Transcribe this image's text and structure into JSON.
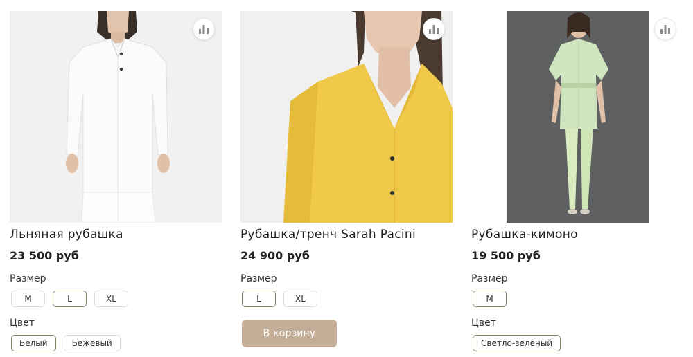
{
  "products": [
    {
      "title": "Льняная рубашка",
      "price": "23 500 руб",
      "size_label": "Размер",
      "sizes": [
        "M",
        "L",
        "XL"
      ],
      "selected_size": "L",
      "color_label": "Цвет",
      "colors": [
        "Белый",
        "Бежевый"
      ],
      "selected_color": "Белый",
      "compare_icon": "bar-chart-icon"
    },
    {
      "title": "Рубашка/тренч Sarah Pacini",
      "price": "24 900 руб",
      "size_label": "Размер",
      "sizes": [
        "L",
        "XL"
      ],
      "selected_size": "L",
      "cart_label": "В корзину",
      "compare_icon": "bar-chart-icon"
    },
    {
      "title": "Рубашка-кимоно",
      "price": "19 500 руб",
      "size_label": "Размер",
      "sizes": [
        "M"
      ],
      "selected_size": "M",
      "color_label": "Цвет",
      "colors": [
        "Светло-зеленый"
      ],
      "selected_color": "Светло-зеленый",
      "compare_icon": "bar-chart-icon"
    }
  ],
  "colors": {
    "accent_button": "#c4ae97",
    "selected_chip_border": "#8a7d68",
    "chip_border": "#dcdcdc"
  }
}
